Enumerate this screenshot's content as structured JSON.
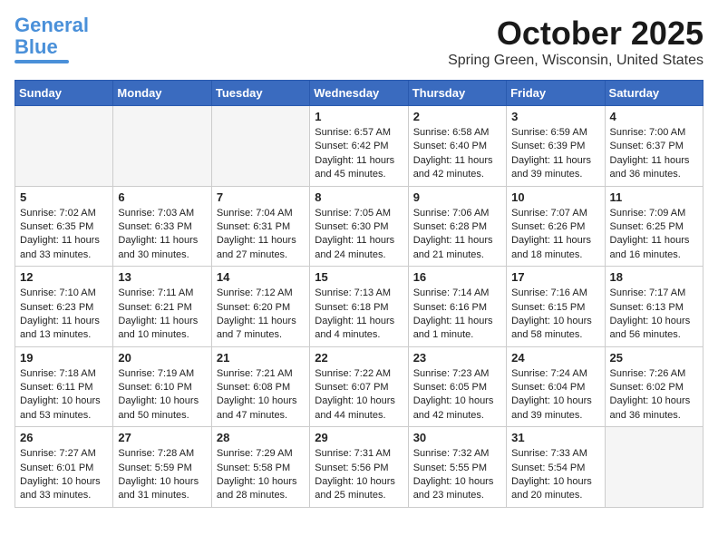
{
  "header": {
    "logo_line1": "General",
    "logo_line2": "Blue",
    "month_title": "October 2025",
    "location": "Spring Green, Wisconsin, United States"
  },
  "weekdays": [
    "Sunday",
    "Monday",
    "Tuesday",
    "Wednesday",
    "Thursday",
    "Friday",
    "Saturday"
  ],
  "weeks": [
    [
      {
        "day": "",
        "content": ""
      },
      {
        "day": "",
        "content": ""
      },
      {
        "day": "",
        "content": ""
      },
      {
        "day": "1",
        "content": "Sunrise: 6:57 AM\nSunset: 6:42 PM\nDaylight: 11 hours\nand 45 minutes."
      },
      {
        "day": "2",
        "content": "Sunrise: 6:58 AM\nSunset: 6:40 PM\nDaylight: 11 hours\nand 42 minutes."
      },
      {
        "day": "3",
        "content": "Sunrise: 6:59 AM\nSunset: 6:39 PM\nDaylight: 11 hours\nand 39 minutes."
      },
      {
        "day": "4",
        "content": "Sunrise: 7:00 AM\nSunset: 6:37 PM\nDaylight: 11 hours\nand 36 minutes."
      }
    ],
    [
      {
        "day": "5",
        "content": "Sunrise: 7:02 AM\nSunset: 6:35 PM\nDaylight: 11 hours\nand 33 minutes."
      },
      {
        "day": "6",
        "content": "Sunrise: 7:03 AM\nSunset: 6:33 PM\nDaylight: 11 hours\nand 30 minutes."
      },
      {
        "day": "7",
        "content": "Sunrise: 7:04 AM\nSunset: 6:31 PM\nDaylight: 11 hours\nand 27 minutes."
      },
      {
        "day": "8",
        "content": "Sunrise: 7:05 AM\nSunset: 6:30 PM\nDaylight: 11 hours\nand 24 minutes."
      },
      {
        "day": "9",
        "content": "Sunrise: 7:06 AM\nSunset: 6:28 PM\nDaylight: 11 hours\nand 21 minutes."
      },
      {
        "day": "10",
        "content": "Sunrise: 7:07 AM\nSunset: 6:26 PM\nDaylight: 11 hours\nand 18 minutes."
      },
      {
        "day": "11",
        "content": "Sunrise: 7:09 AM\nSunset: 6:25 PM\nDaylight: 11 hours\nand 16 minutes."
      }
    ],
    [
      {
        "day": "12",
        "content": "Sunrise: 7:10 AM\nSunset: 6:23 PM\nDaylight: 11 hours\nand 13 minutes."
      },
      {
        "day": "13",
        "content": "Sunrise: 7:11 AM\nSunset: 6:21 PM\nDaylight: 11 hours\nand 10 minutes."
      },
      {
        "day": "14",
        "content": "Sunrise: 7:12 AM\nSunset: 6:20 PM\nDaylight: 11 hours\nand 7 minutes."
      },
      {
        "day": "15",
        "content": "Sunrise: 7:13 AM\nSunset: 6:18 PM\nDaylight: 11 hours\nand 4 minutes."
      },
      {
        "day": "16",
        "content": "Sunrise: 7:14 AM\nSunset: 6:16 PM\nDaylight: 11 hours\nand 1 minute."
      },
      {
        "day": "17",
        "content": "Sunrise: 7:16 AM\nSunset: 6:15 PM\nDaylight: 10 hours\nand 58 minutes."
      },
      {
        "day": "18",
        "content": "Sunrise: 7:17 AM\nSunset: 6:13 PM\nDaylight: 10 hours\nand 56 minutes."
      }
    ],
    [
      {
        "day": "19",
        "content": "Sunrise: 7:18 AM\nSunset: 6:11 PM\nDaylight: 10 hours\nand 53 minutes."
      },
      {
        "day": "20",
        "content": "Sunrise: 7:19 AM\nSunset: 6:10 PM\nDaylight: 10 hours\nand 50 minutes."
      },
      {
        "day": "21",
        "content": "Sunrise: 7:21 AM\nSunset: 6:08 PM\nDaylight: 10 hours\nand 47 minutes."
      },
      {
        "day": "22",
        "content": "Sunrise: 7:22 AM\nSunset: 6:07 PM\nDaylight: 10 hours\nand 44 minutes."
      },
      {
        "day": "23",
        "content": "Sunrise: 7:23 AM\nSunset: 6:05 PM\nDaylight: 10 hours\nand 42 minutes."
      },
      {
        "day": "24",
        "content": "Sunrise: 7:24 AM\nSunset: 6:04 PM\nDaylight: 10 hours\nand 39 minutes."
      },
      {
        "day": "25",
        "content": "Sunrise: 7:26 AM\nSunset: 6:02 PM\nDaylight: 10 hours\nand 36 minutes."
      }
    ],
    [
      {
        "day": "26",
        "content": "Sunrise: 7:27 AM\nSunset: 6:01 PM\nDaylight: 10 hours\nand 33 minutes."
      },
      {
        "day": "27",
        "content": "Sunrise: 7:28 AM\nSunset: 5:59 PM\nDaylight: 10 hours\nand 31 minutes."
      },
      {
        "day": "28",
        "content": "Sunrise: 7:29 AM\nSunset: 5:58 PM\nDaylight: 10 hours\nand 28 minutes."
      },
      {
        "day": "29",
        "content": "Sunrise: 7:31 AM\nSunset: 5:56 PM\nDaylight: 10 hours\nand 25 minutes."
      },
      {
        "day": "30",
        "content": "Sunrise: 7:32 AM\nSunset: 5:55 PM\nDaylight: 10 hours\nand 23 minutes."
      },
      {
        "day": "31",
        "content": "Sunrise: 7:33 AM\nSunset: 5:54 PM\nDaylight: 10 hours\nand 20 minutes."
      },
      {
        "day": "",
        "content": ""
      }
    ]
  ]
}
